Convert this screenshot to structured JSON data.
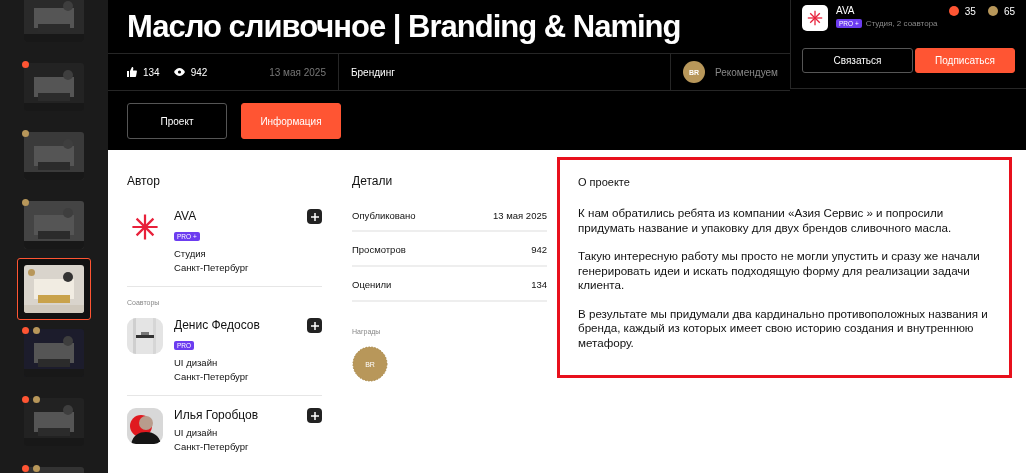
{
  "thumbnails": [
    {
      "selected": false
    },
    {
      "selected": false,
      "dots": [
        {
          "color": "#ff5533"
        }
      ]
    },
    {
      "selected": false,
      "dots": [
        {
          "color": "#b8975a"
        }
      ]
    },
    {
      "selected": false,
      "dots": [
        {
          "color": "#b8975a"
        }
      ]
    },
    {
      "selected": true,
      "dots": [
        {
          "color": "#b8975a"
        }
      ]
    },
    {
      "selected": false,
      "dots": [
        {
          "color": "#ff5533"
        },
        {
          "color": "#b8975a"
        }
      ]
    },
    {
      "selected": false,
      "dots": [
        {
          "color": "#ff5533"
        },
        {
          "color": "#b8975a"
        }
      ]
    },
    {
      "selected": false,
      "dots": [
        {
          "color": "#ff5533"
        },
        {
          "color": "#b8975a"
        }
      ]
    }
  ],
  "title": "Масло сливочное | Branding & Naming",
  "stats": {
    "likes": "134",
    "views": "942",
    "date": "13 мая 2025",
    "category": "Брендинг",
    "award_badge": "BR",
    "award_label": "Рекомендуем"
  },
  "tabs": [
    {
      "label": "Проект",
      "selected": false
    },
    {
      "label": "Информация",
      "selected": true
    }
  ],
  "studio": {
    "name": "AVA",
    "badge": "PRO +",
    "subtitle": "Студия, 2 соавтора",
    "red_count": "35",
    "gold_count": "65",
    "contact_button": "Связаться",
    "subscribe_button": "Подписаться"
  },
  "author": {
    "heading": "Автор",
    "coauthors_label": "Соавторы",
    "people": [
      {
        "kind": "logo",
        "name": "AVA",
        "badge": "PRO +",
        "role": "Студия",
        "city": "Санкт-Петербург"
      },
      {
        "name": "Денис Федосов",
        "badge": "PRO",
        "role": "UI дизайн",
        "city": "Санкт-Петербург"
      },
      {
        "kind": "portrait",
        "name": "Илья Горобцов",
        "role": "UI дизайн",
        "city": "Санкт-Петербург"
      }
    ]
  },
  "details": {
    "heading": "Детали",
    "rows": [
      {
        "label": "Опубликовано",
        "value": "13 мая 2025"
      },
      {
        "label": "Просмотров",
        "value": "942"
      },
      {
        "label": "Оценили",
        "value": "134"
      }
    ],
    "awards_label": "Награды",
    "award_badge": "BR"
  },
  "about": {
    "heading": "О проекте",
    "paragraphs": [
      "К нам обратились ребята из компании «Азия Сервис » и попросили придумать название и упаковку для двух брендов сливочного масла.",
      "Такую интересную работу мы просто не могли упустить и сразу же начали генерировать идеи и искать подходящую форму для реализации задачи клиента.",
      "В результате мы придумали два кардинально противоположных названия и бренда, каждый из которых имеет свою историю создания и внутреннюю метафору."
    ]
  }
}
